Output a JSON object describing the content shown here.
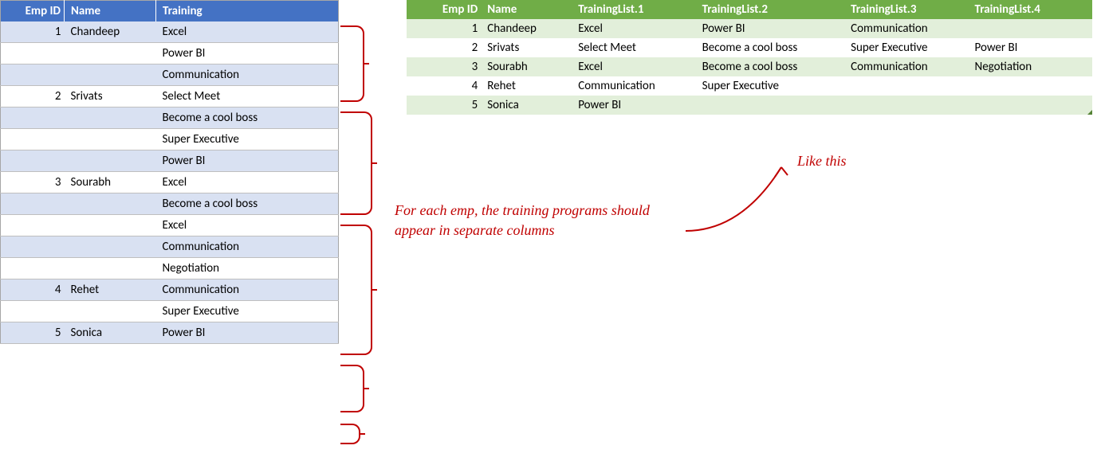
{
  "leftTable": {
    "headers": {
      "id": "Emp ID",
      "name": "Name",
      "training": "Training"
    },
    "rows": [
      {
        "id": "1",
        "name": "Chandeep",
        "training": "Excel"
      },
      {
        "id": "",
        "name": "",
        "training": "Power BI"
      },
      {
        "id": "",
        "name": "",
        "training": "Communication"
      },
      {
        "id": "2",
        "name": "Srivats",
        "training": "Select Meet"
      },
      {
        "id": "",
        "name": "",
        "training": "Become a cool boss"
      },
      {
        "id": "",
        "name": "",
        "training": "Super Executive"
      },
      {
        "id": "",
        "name": "",
        "training": "Power BI"
      },
      {
        "id": "3",
        "name": "Sourabh",
        "training": "Excel"
      },
      {
        "id": "",
        "name": "",
        "training": "Become a cool boss"
      },
      {
        "id": "",
        "name": "",
        "training": "Excel"
      },
      {
        "id": "",
        "name": "",
        "training": "Communication"
      },
      {
        "id": "",
        "name": "",
        "training": "Negotiation"
      },
      {
        "id": "4",
        "name": "Rehet",
        "training": "Communication"
      },
      {
        "id": "",
        "name": "",
        "training": "Super Executive"
      },
      {
        "id": "5",
        "name": "Sonica",
        "training": "Power BI"
      }
    ]
  },
  "rightTable": {
    "headers": {
      "id": "Emp ID",
      "name": "Name",
      "t1": "TrainingList.1",
      "t2": "TrainingList.2",
      "t3": "TrainingList.3",
      "t4": "TrainingList.4"
    },
    "rows": [
      {
        "id": "1",
        "name": "Chandeep",
        "t1": "Excel",
        "t2": "Power BI",
        "t3": "Communication",
        "t4": ""
      },
      {
        "id": "2",
        "name": "Srivats",
        "t1": "Select Meet",
        "t2": "Become a cool boss",
        "t3": "Super Executive",
        "t4": "Power BI"
      },
      {
        "id": "3",
        "name": "Sourabh",
        "t1": "Excel",
        "t2": "Become a cool boss",
        "t3": "Communication",
        "t4": "Negotiation"
      },
      {
        "id": "4",
        "name": "Rehet",
        "t1": "Communication",
        "t2": "Super Executive",
        "t3": "",
        "t4": ""
      },
      {
        "id": "5",
        "name": "Sonica",
        "t1": "Power BI",
        "t2": "",
        "t3": "",
        "t4": ""
      }
    ]
  },
  "annotations": {
    "main": "For each emp, the training programs should appear in separate columns",
    "likeThis": "Like this"
  }
}
